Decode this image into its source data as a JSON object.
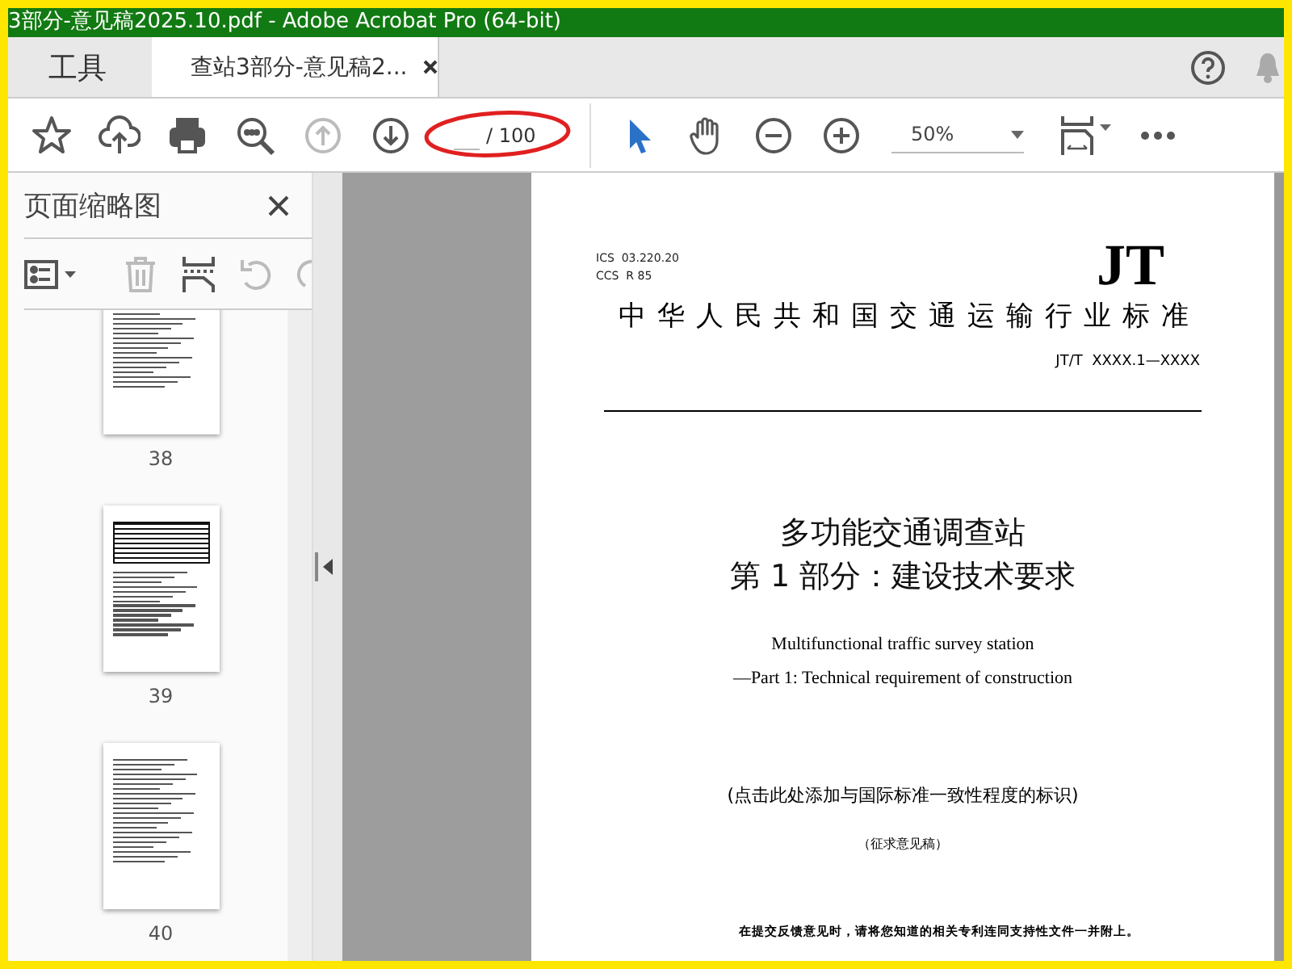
{
  "window": {
    "title": "3部分-意见稿2025.10.pdf - Adobe Acrobat Pro (64-bit)"
  },
  "tabs": [
    {
      "label": "工具",
      "selected": false
    },
    {
      "label": "查站3部分-意见稿2...",
      "selected": true
    }
  ],
  "toolbar": [
    {
      "kind": "star",
      "disabled": false
    },
    {
      "kind": "upload",
      "disabled": false
    },
    {
      "kind": "print",
      "disabled": false
    },
    {
      "kind": "search",
      "disabled": false
    },
    {
      "kind": "prev",
      "disabled": true
    },
    {
      "kind": "next",
      "disabled": false
    }
  ],
  "page_nav": {
    "total": "/ 100"
  },
  "tools": [
    {
      "kind": "select"
    },
    {
      "kind": "hand"
    },
    {
      "kind": "zoom-out"
    },
    {
      "kind": "zoom-in"
    }
  ],
  "zoom": {
    "value": "50%"
  },
  "sidebar": {
    "title": "页面缩略图",
    "tools": [
      {
        "kind": "options",
        "disabled": false
      },
      {
        "kind": "delete",
        "disabled": true
      },
      {
        "kind": "extract",
        "disabled": false
      },
      {
        "kind": "undo",
        "disabled": true
      },
      {
        "kind": "redo",
        "disabled": true
      }
    ],
    "thumbnails": [
      {
        "label": "38",
        "kind": "text"
      },
      {
        "label": "39",
        "kind": "table"
      },
      {
        "label": "40",
        "kind": "text"
      }
    ]
  },
  "document": {
    "ics": "ICS  03.220.20",
    "ccs": "CCS  R 85",
    "logo": "JT",
    "standard": "中华人民共和国交通运输行业标准",
    "code": "JT/T  XXXX.1—XXXX",
    "title_lines": [
      "多功能交通调查站",
      "第 1 部分：建设技术要求"
    ],
    "english_lines": [
      "Multifunctional traffic survey station",
      "—Part 1: Technical requirement of construction"
    ],
    "conformity": "(点击此处添加与国际标准一致性程度的标识)",
    "draft": "（征求意见稿）",
    "footnote": "在提交反馈意见时，请将您知道的相关专利连同支持性文件一并附上。"
  }
}
